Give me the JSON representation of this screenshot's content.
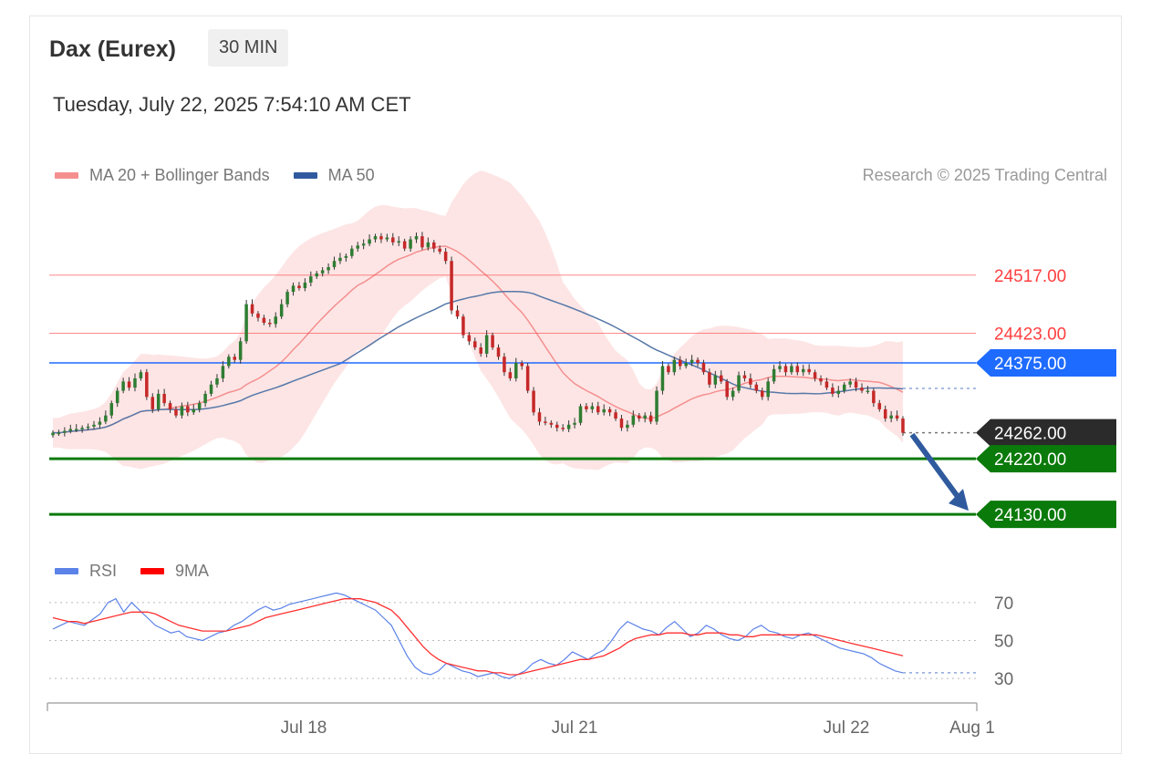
{
  "header": {
    "instrument": "Dax (Eurex)",
    "timeframe": "30 MIN",
    "timestamp": "Tuesday, July 22, 2025 7:54:10 AM CET"
  },
  "legend": {
    "ma20_label": "MA 20 + Bollinger Bands",
    "ma50_label": "MA 50",
    "rsi_label": "RSI",
    "rsi9_label": "9MA"
  },
  "credit": "Research © 2025 Trading Central",
  "colors": {
    "ma20": "#f58f8f",
    "band": "#fde0e0",
    "ma50": "#5678a8",
    "up": "#2e7d32",
    "down": "#c62828",
    "resistance": "#ff4040",
    "pivot": "#1e6bff",
    "current": "#2b2b2b",
    "support": "#0a7a0a",
    "arrow": "#2f5a9e",
    "rsi": "#5b82e8",
    "rsi9": "#ff3030"
  },
  "chart_data": [
    {
      "type": "candlestick",
      "ylim": [
        24080,
        24620
      ],
      "levels": [
        {
          "name": "resistance-2",
          "value": 24517.0,
          "label": "24517.00",
          "style": "line"
        },
        {
          "name": "resistance-1",
          "value": 24423.0,
          "label": "24423.00",
          "style": "line"
        },
        {
          "name": "pivot",
          "value": 24375.0,
          "label": "24375.00",
          "style": "badge"
        },
        {
          "name": "current-price",
          "value": 24262.0,
          "label": "24262.00",
          "style": "badge"
        },
        {
          "name": "support-1",
          "value": 24220.0,
          "label": "24220.00",
          "style": "badge"
        },
        {
          "name": "support-2",
          "value": 24130.0,
          "label": "24130.00",
          "style": "badge"
        }
      ],
      "x_ticks": [
        "Jul 18",
        "Jul 21",
        "Jul 22",
        "Aug 1"
      ],
      "candles_close": [
        24262,
        24262,
        24265,
        24268,
        24268,
        24270,
        24272,
        24275,
        24280,
        24290,
        24310,
        24330,
        24345,
        24335,
        24350,
        24360,
        24320,
        24300,
        24325,
        24310,
        24300,
        24290,
        24305,
        24295,
        24300,
        24310,
        24325,
        24340,
        24350,
        24370,
        24385,
        24380,
        24410,
        24470,
        24455,
        24448,
        24440,
        24438,
        24450,
        24470,
        24490,
        24500,
        24496,
        24505,
        24515,
        24520,
        24525,
        24530,
        24540,
        24545,
        24548,
        24560,
        24565,
        24568,
        24575,
        24580,
        24575,
        24578,
        24570,
        24572,
        24560,
        24575,
        24580,
        24562,
        24570,
        24560,
        24555,
        24540,
        24460,
        24450,
        24420,
        24410,
        24400,
        24390,
        24420,
        24400,
        24385,
        24360,
        24350,
        24375,
        24370,
        24330,
        24295,
        24280,
        24278,
        24275,
        24270,
        24268,
        24275,
        24278,
        24305,
        24300,
        24305,
        24295,
        24300,
        24295,
        24285,
        24270,
        24275,
        24290,
        24285,
        24290,
        24280,
        24330,
        24370,
        24360,
        24380,
        24370,
        24375,
        24380,
        24375,
        24360,
        24340,
        24355,
        24345,
        24320,
        24330,
        24355,
        24350,
        24340,
        24330,
        24320,
        24345,
        24365,
        24370,
        24360,
        24370,
        24360,
        24365,
        24360,
        24350,
        24345,
        24335,
        24325,
        24330,
        24340,
        24345,
        24335,
        24330,
        24330,
        24310,
        24300,
        24285,
        24290,
        24285,
        24262
      ],
      "candles_open": [
        24258,
        24262,
        24262,
        24265,
        24268,
        24268,
        24270,
        24272,
        24275,
        24280,
        24290,
        24310,
        24330,
        24345,
        24335,
        24350,
        24360,
        24320,
        24300,
        24325,
        24310,
        24300,
        24290,
        24305,
        24295,
        24300,
        24310,
        24325,
        24340,
        24350,
        24370,
        24385,
        24380,
        24410,
        24470,
        24455,
        24448,
        24440,
        24438,
        24450,
        24470,
        24490,
        24500,
        24496,
        24505,
        24515,
        24520,
        24525,
        24530,
        24540,
        24545,
        24548,
        24560,
        24565,
        24568,
        24575,
        24580,
        24575,
        24578,
        24570,
        24572,
        24560,
        24575,
        24580,
        24562,
        24570,
        24560,
        24555,
        24540,
        24460,
        24450,
        24420,
        24410,
        24400,
        24390,
        24420,
        24400,
        24385,
        24360,
        24350,
        24375,
        24370,
        24330,
        24295,
        24280,
        24278,
        24275,
        24270,
        24268,
        24275,
        24278,
        24305,
        24300,
        24305,
        24295,
        24300,
        24295,
        24285,
        24270,
        24275,
        24290,
        24285,
        24290,
        24280,
        24330,
        24370,
        24360,
        24380,
        24370,
        24375,
        24380,
        24375,
        24360,
        24340,
        24355,
        24345,
        24320,
        24330,
        24355,
        24350,
        24340,
        24330,
        24320,
        24345,
        24365,
        24370,
        24360,
        24370,
        24360,
        24365,
        24360,
        24350,
        24345,
        24335,
        24325,
        24330,
        24340,
        24345,
        24335,
        24330,
        24330,
        24310,
        24300,
        24285,
        24290,
        24285
      ]
    },
    {
      "type": "line",
      "name": "RSI",
      "ylim": [
        20,
        80
      ],
      "y_ticks": [
        70,
        50,
        30
      ],
      "rsi": [
        56,
        58,
        60,
        59,
        58,
        61,
        64,
        70,
        72,
        65,
        70,
        66,
        62,
        58,
        56,
        54,
        55,
        52,
        51,
        50,
        52,
        54,
        55,
        58,
        60,
        63,
        66,
        68,
        66,
        67,
        69,
        70,
        71,
        72,
        73,
        74,
        75,
        74,
        72,
        70,
        68,
        66,
        62,
        58,
        50,
        42,
        36,
        33,
        32,
        34,
        38,
        36,
        34,
        33,
        31,
        32,
        33,
        31,
        30,
        32,
        34,
        38,
        40,
        38,
        37,
        40,
        44,
        42,
        40,
        43,
        45,
        50,
        56,
        60,
        58,
        56,
        55,
        53,
        57,
        60,
        56,
        52,
        54,
        58,
        56,
        53,
        51,
        50,
        52,
        56,
        58,
        55,
        54,
        52,
        51,
        53,
        54,
        52,
        50,
        48,
        46,
        45,
        44,
        43,
        41,
        38,
        36,
        34,
        33
      ],
      "rsi9": [
        62,
        61,
        60,
        60,
        59,
        60,
        61,
        62,
        63,
        64,
        65,
        65,
        65,
        64,
        62,
        60,
        58,
        57,
        56,
        55,
        55,
        55,
        55,
        56,
        57,
        58,
        60,
        62,
        63,
        64,
        65,
        66,
        67,
        68,
        69,
        70,
        71,
        72,
        72,
        72,
        71,
        70,
        68,
        66,
        62,
        57,
        52,
        47,
        43,
        40,
        38,
        37,
        36,
        35,
        34,
        34,
        33,
        33,
        32,
        32,
        33,
        34,
        35,
        36,
        37,
        38,
        39,
        40,
        40,
        41,
        42,
        44,
        46,
        49,
        51,
        52,
        53,
        53,
        54,
        54,
        54,
        53,
        53,
        54,
        54,
        54,
        53,
        53,
        52,
        52,
        53,
        53,
        53,
        53,
        53,
        53,
        53,
        53,
        52,
        51,
        50,
        49,
        48,
        47,
        46,
        45,
        44,
        43,
        42
      ]
    }
  ]
}
